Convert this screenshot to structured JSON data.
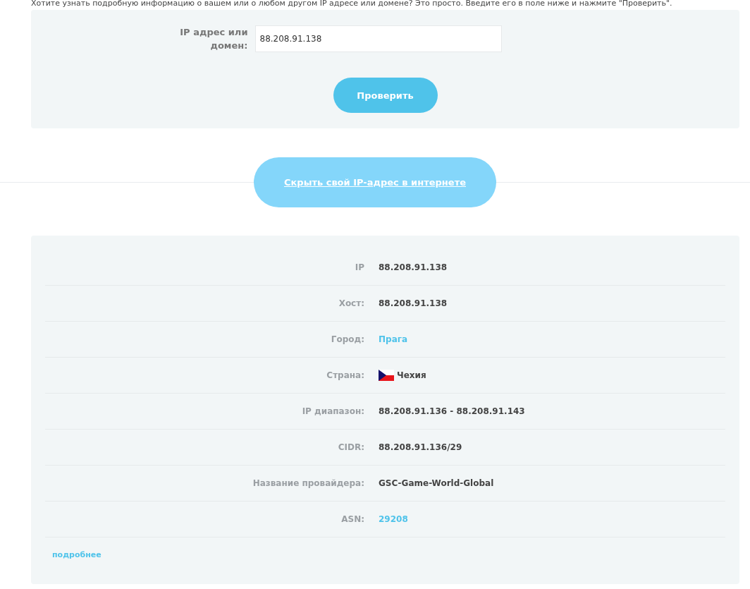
{
  "intro": "Хотите узнать подробную информацию о вашем или о любом другом IP адресе или домене? Это просто. Введите его в поле ниже и нажмите \"Проверить\".",
  "form": {
    "label": "IP адрес или домен:",
    "value": "88.208.91.138",
    "button": "Проверить"
  },
  "hide_link": "Скрыть свой IP-адрес в интернете",
  "rows": [
    {
      "label": "IP",
      "value": "88.208.91.138",
      "kind": "text"
    },
    {
      "label": "Хост:",
      "value": "88.208.91.138",
      "kind": "text"
    },
    {
      "label": "Город:",
      "value": "Прага",
      "kind": "link"
    },
    {
      "label": "Страна:",
      "value": "Чехия",
      "kind": "flag"
    },
    {
      "label": "IP диапазон:",
      "value": "88.208.91.136 - 88.208.91.143",
      "kind": "text"
    },
    {
      "label": "CIDR:",
      "value": "88.208.91.136/29",
      "kind": "text"
    },
    {
      "label": "Название провайдера:",
      "value": "GSC-Game-World-Global",
      "kind": "text"
    },
    {
      "label": "ASN:",
      "value": "29208",
      "kind": "link"
    }
  ],
  "more_link": "подробнее"
}
